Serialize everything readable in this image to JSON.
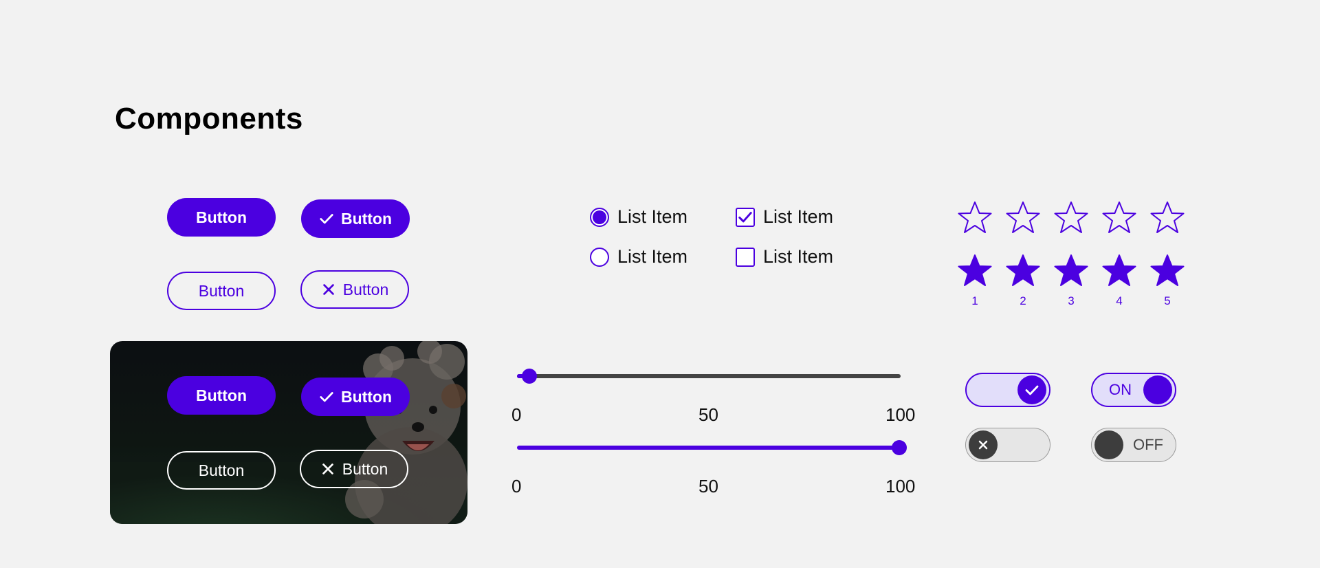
{
  "page": {
    "title": "Components"
  },
  "colors": {
    "accent": "#4b00e0",
    "background": "#f2f2f2",
    "off_knob": "#3d3d3d"
  },
  "buttons": {
    "filled_label": "Button",
    "filled_check_label": "Button",
    "outline_label": "Button",
    "outline_close_label": "Button"
  },
  "image_card": {
    "filled_label": "Button",
    "filled_check_label": "Button",
    "outline_label": "Button",
    "outline_close_label": "Button"
  },
  "radio_list": [
    {
      "label": "List Item",
      "selected": true
    },
    {
      "label": "List Item",
      "selected": false
    }
  ],
  "checkbox_list": [
    {
      "label": "List Item",
      "checked": true
    },
    {
      "label": "List Item",
      "checked": false
    }
  ],
  "rating": {
    "empty_row_filled": 0,
    "filled_row_filled": 5,
    "max": 5,
    "labels": [
      "1",
      "2",
      "3",
      "4",
      "5"
    ]
  },
  "sliders": [
    {
      "min": 0,
      "max": 100,
      "value": 3,
      "ticks": [
        "0",
        "50",
        "100"
      ]
    },
    {
      "min": 0,
      "max": 100,
      "value": 100,
      "ticks": [
        "0",
        "50",
        "100"
      ]
    }
  ],
  "toggles": {
    "icon_on": {
      "state": "on",
      "icon": "check-icon"
    },
    "text_on": {
      "state": "on",
      "label": "ON"
    },
    "icon_off": {
      "state": "off",
      "icon": "close-icon"
    },
    "text_off": {
      "state": "off",
      "label": "OFF"
    }
  }
}
